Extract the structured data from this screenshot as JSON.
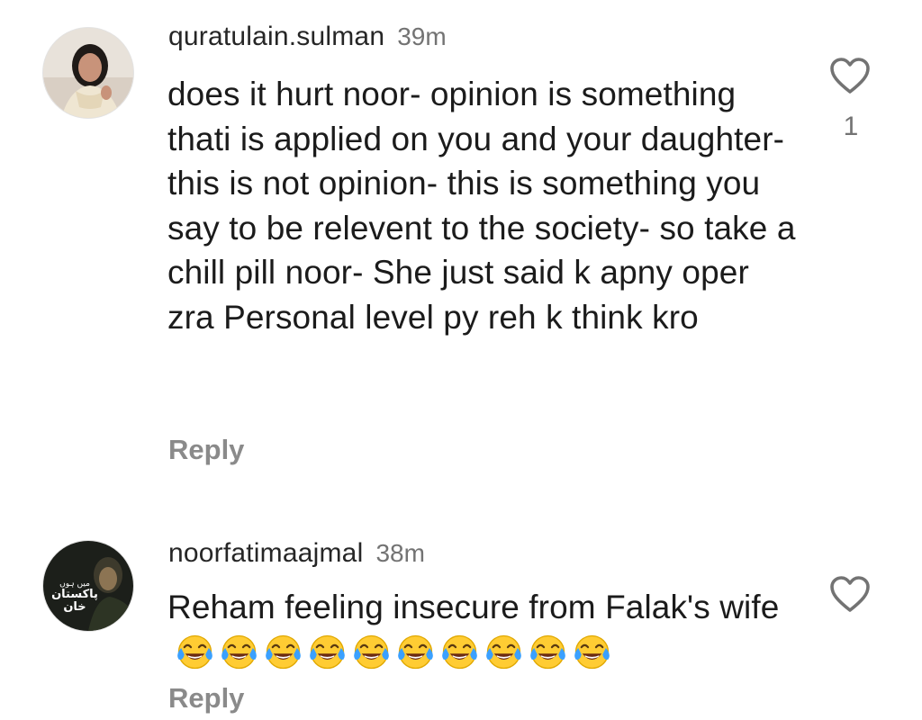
{
  "comments": [
    {
      "username": "quratulain.sulman",
      "time": "39m",
      "text": "does it hurt noor-  opinion is something thati is applied on you and your daughter-  this is not opinion- this is something you say to be relevent to the society- so take a chill pill noor- She just said k apny oper zra Personal level py reh k think kro",
      "reply_label": "Reply",
      "like_count": "1",
      "icons": {
        "like": "heart-outline-icon"
      }
    },
    {
      "username": "noorfatimaajmal",
      "time": "38m",
      "text": "Reham feeling insecure from Falak's wife",
      "emoji_count": 10,
      "emoji_name": "face-with-tears-of-joy-emoji",
      "reply_label": "Reply",
      "avatar_text_line1": "میں ہوں",
      "avatar_text_line2": "پاکستان خان",
      "icons": {
        "like": "heart-outline-icon"
      }
    }
  ],
  "colors": {
    "text": "#1b1b1b",
    "secondary": "#737373",
    "reply": "#8a8a8a",
    "emoji_face": "#ffcc33",
    "emoji_tear": "#3aa0ff"
  }
}
